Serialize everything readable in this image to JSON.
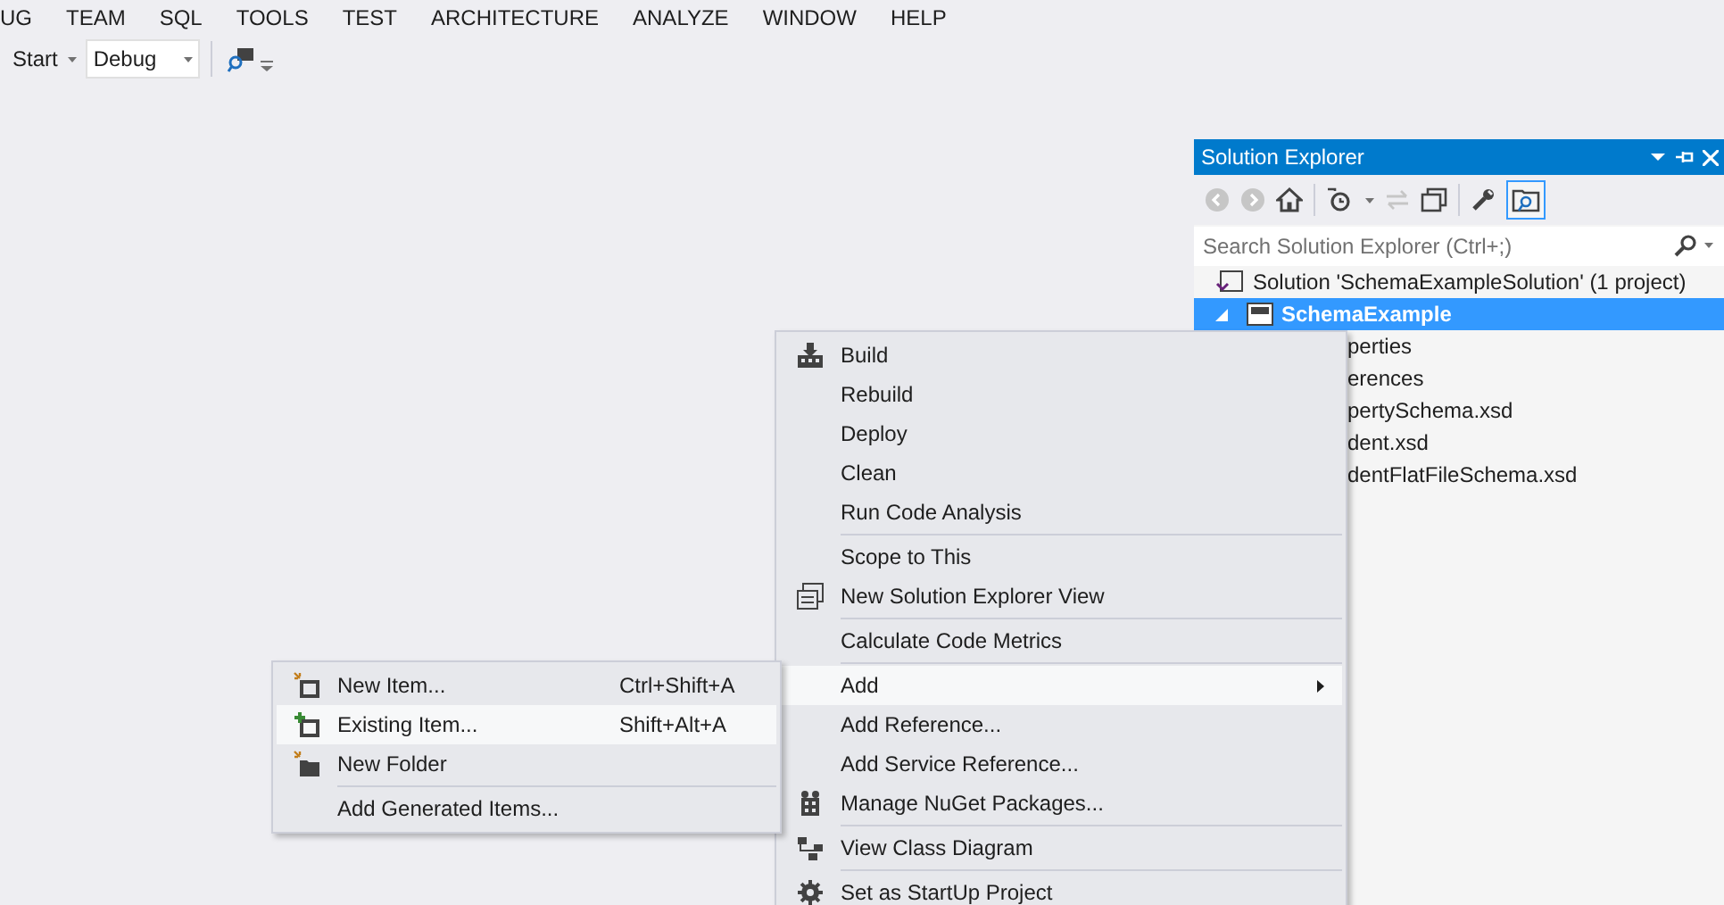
{
  "menu_bar": [
    "UG",
    "TEAM",
    "SQL",
    "TOOLS",
    "TEST",
    "ARCHITECTURE",
    "ANALYZE",
    "WINDOW",
    "HELP"
  ],
  "toolbar": {
    "start_label": "Start",
    "configuration": "Debug"
  },
  "solution_explorer": {
    "title": "Solution Explorer",
    "search": {
      "placeholder": "Search Solution Explorer (Ctrl+;)"
    },
    "tree": [
      {
        "label": "Solution 'SchemaExampleSolution' (1 project)",
        "selected": false,
        "children": [
          {
            "label": "SchemaExample",
            "selected": true,
            "expanded": true,
            "children": [
              {
                "label": "perties",
                "selected": false
              },
              {
                "label": "erences",
                "selected": false
              },
              {
                "label": "pertySchema.xsd",
                "selected": false
              },
              {
                "label": "dent.xsd",
                "selected": false
              },
              {
                "label": "dentFlatFileSchema.xsd",
                "selected": false
              }
            ]
          }
        ]
      }
    ]
  },
  "context_menu": [
    {
      "kind": "item",
      "label": "Build",
      "selected": false
    },
    {
      "kind": "item",
      "label": "Rebuild",
      "selected": false
    },
    {
      "kind": "item",
      "label": "Deploy",
      "selected": false
    },
    {
      "kind": "item",
      "label": "Clean",
      "selected": false
    },
    {
      "kind": "item",
      "label": "Run Code Analysis",
      "selected": false
    },
    {
      "kind": "separator"
    },
    {
      "kind": "item",
      "label": "Scope to This",
      "selected": false
    },
    {
      "kind": "item",
      "label": "New Solution Explorer View",
      "selected": false
    },
    {
      "kind": "separator"
    },
    {
      "kind": "item",
      "label": "Calculate Code Metrics",
      "selected": false
    },
    {
      "kind": "separator"
    },
    {
      "kind": "submenu",
      "label": "Add",
      "selected": true
    },
    {
      "kind": "item",
      "label": "Add Reference...",
      "selected": false
    },
    {
      "kind": "item",
      "label": "Add Service Reference...",
      "selected": false
    },
    {
      "kind": "item",
      "label": "Manage NuGet Packages...",
      "selected": false
    },
    {
      "kind": "separator"
    },
    {
      "kind": "item",
      "label": "View Class Diagram",
      "selected": false
    },
    {
      "kind": "separator"
    },
    {
      "kind": "item",
      "label": "Set as StartUp Project",
      "selected": false
    }
  ],
  "add_submenu": [
    {
      "kind": "item",
      "label": "New Item...",
      "shortcut": "Ctrl+Shift+A",
      "selected": false
    },
    {
      "kind": "item",
      "label": "Existing Item...",
      "shortcut": "Shift+Alt+A",
      "selected": true
    },
    {
      "kind": "item",
      "label": "New Folder",
      "selected": false
    },
    {
      "kind": "separator"
    },
    {
      "kind": "item",
      "label": "Add Generated Items...",
      "selected": false
    }
  ]
}
